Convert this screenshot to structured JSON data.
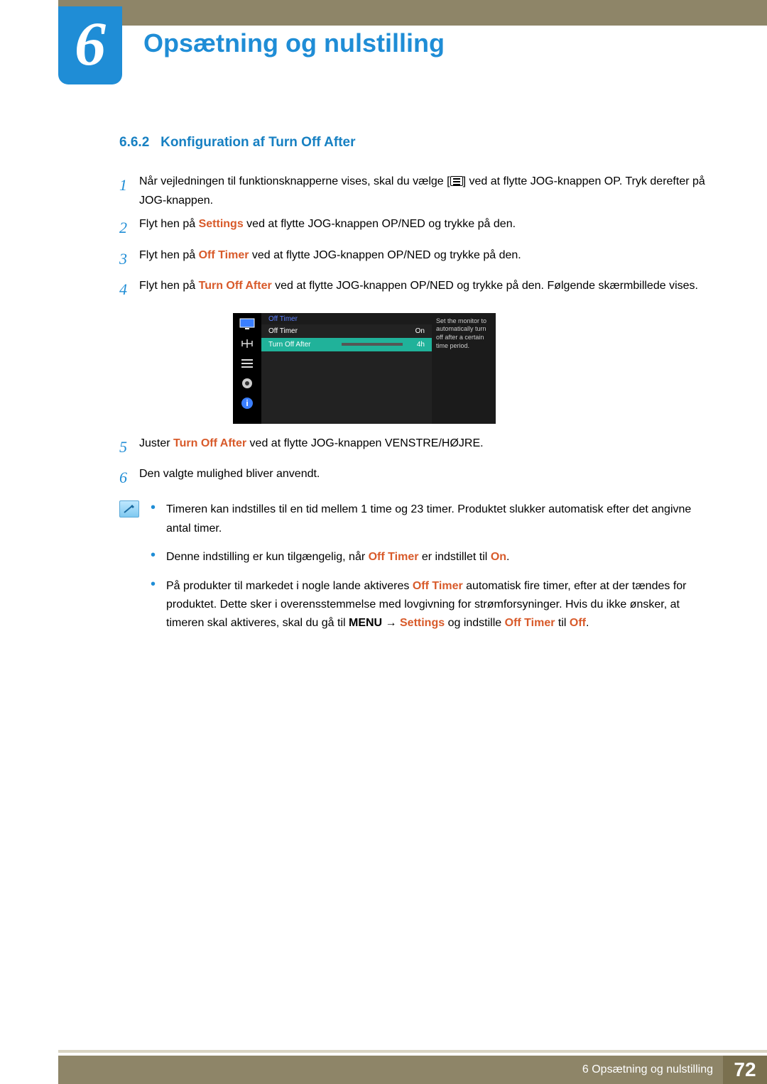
{
  "chapter": {
    "number": "6",
    "title": "Opsætning og nulstilling"
  },
  "section": {
    "number": "6.6.2",
    "title": "Konfiguration af Turn Off After"
  },
  "steps": {
    "s1a": "Når vejledningen til funktionsknapperne vises, skal du vælge [",
    "s1b": "] ved at flytte JOG-knappen OP. Tryk derefter på JOG-knappen.",
    "s2a": "Flyt hen på ",
    "s2kw": "Settings",
    "s2b": " ved at flytte JOG-knappen OP/NED og trykke på den.",
    "s3a": "Flyt hen på ",
    "s3kw": "Off Timer",
    "s3b": " ved at flytte JOG-knappen OP/NED og trykke på den.",
    "s4a": "Flyt hen på ",
    "s4kw": "Turn Off After",
    "s4b": " ved at flytte JOG-knappen OP/NED og trykke på den. Følgende skærmbillede vises.",
    "s5a": "Juster ",
    "s5kw": "Turn Off After",
    "s5b": " ved at flytte JOG-knappen VENSTRE/HØJRE.",
    "s6": "Den valgte mulighed bliver anvendt."
  },
  "osd": {
    "title": "Off Timer",
    "row1_label": "Off Timer",
    "row1_value": "On",
    "row2_label": "Turn Off After",
    "row2_value": "4h",
    "help": "Set the monitor to automatically turn off after a certain time period."
  },
  "notes": {
    "n1": "Timeren kan indstilles til en tid mellem 1 time og 23 timer. Produktet slukker automatisk efter det angivne antal timer.",
    "n2a": "Denne indstilling er kun tilgængelig, når ",
    "n2kw1": "Off Timer",
    "n2b": " er indstillet til ",
    "n2kw2": "On",
    "n2c": ".",
    "n3a": "På produkter til markedet i nogle lande aktiveres ",
    "n3kw1": "Off Timer",
    "n3b": " automatisk fire timer, efter at der tændes for produktet. Dette sker i overensstemmelse med lovgivning for strømforsyninger. Hvis du ikke ønsker, at timeren skal aktiveres, skal du gå til ",
    "n3kw2": "MENU",
    "n3arrow": " → ",
    "n3kw3": "Settings",
    "n3c": " og indstille ",
    "n3kw4": "Off Timer",
    "n3d": " til ",
    "n3kw5": "Off",
    "n3e": "."
  },
  "footer": {
    "label": "6 Opsætning og nulstilling",
    "page": "72"
  }
}
